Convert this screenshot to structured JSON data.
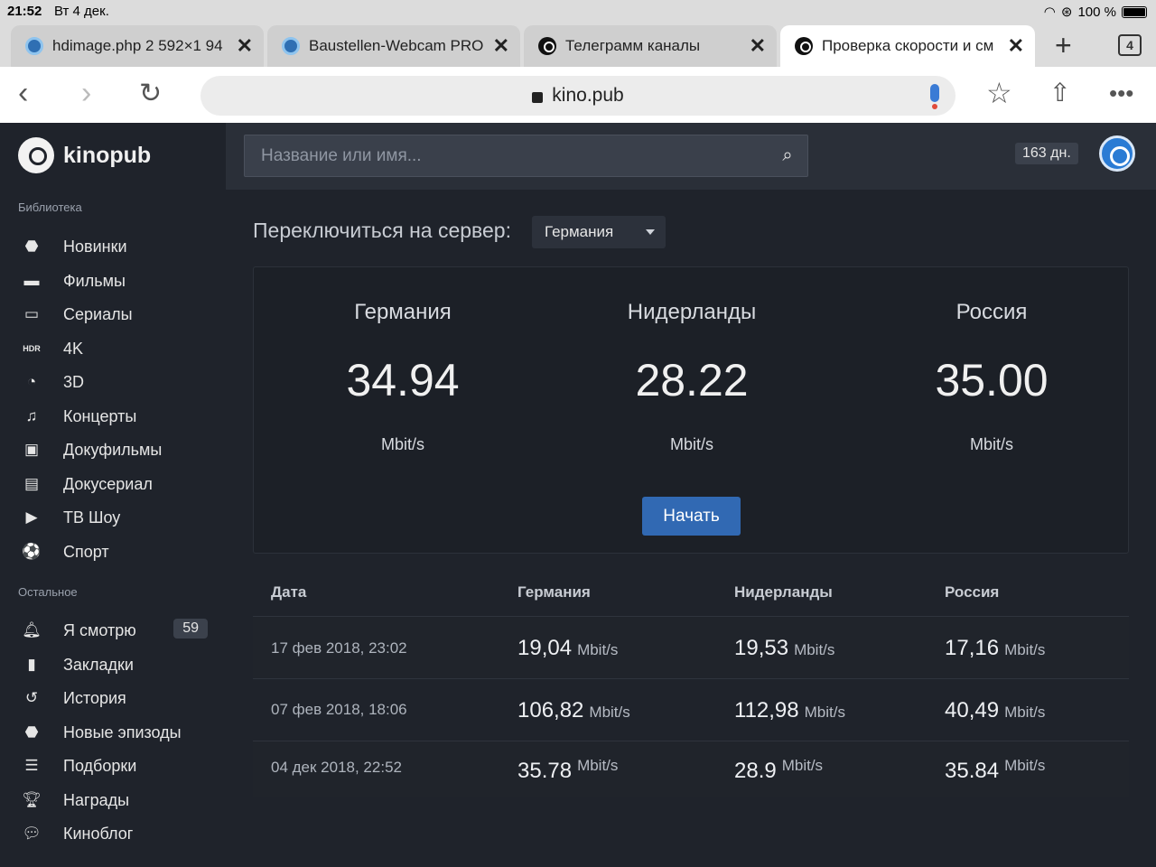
{
  "status_bar": {
    "time": "21:52",
    "date": "Вт 4 дек.",
    "battery": "100 %"
  },
  "tabs": [
    {
      "title": "hdimage.php 2 592×1 94",
      "favicon": "camera-icon"
    },
    {
      "title": "Baustellen-Webcam PRO",
      "favicon": "camera-icon"
    },
    {
      "title": "Телеграмм каналы",
      "favicon": "kinopub-icon"
    },
    {
      "title": "Проверка скорости и см",
      "favicon": "kinopub-icon",
      "active": true
    }
  ],
  "tab_count": "4",
  "address_bar": {
    "url": "kino.pub"
  },
  "sidebar": {
    "logo": "kinopub",
    "library_heading": "Библиотека",
    "library": [
      {
        "label": "Новинки",
        "icon": "alert-icon"
      },
      {
        "label": "Фильмы",
        "icon": "film-icon"
      },
      {
        "label": "Сериалы",
        "icon": "tv-icon"
      },
      {
        "label": "4K",
        "icon": "hdr-icon",
        "icon_text": "HDR"
      },
      {
        "label": "3D",
        "icon": "3d-icon"
      },
      {
        "label": "Концерты",
        "icon": "music-icon"
      },
      {
        "label": "Докуфильмы",
        "icon": "archive-icon"
      },
      {
        "label": "Докусериал",
        "icon": "document-icon"
      },
      {
        "label": "ТВ Шоу",
        "icon": "tv-show-icon"
      },
      {
        "label": "Спорт",
        "icon": "soccer-ball-icon"
      }
    ],
    "other_heading": "Остальное",
    "other": [
      {
        "label": "Я смотрю",
        "icon": "bell-icon",
        "badge": "59"
      },
      {
        "label": "Закладки",
        "icon": "bookmark-icon"
      },
      {
        "label": "История",
        "icon": "history-icon"
      },
      {
        "label": "Новые эпизоды",
        "icon": "alert-icon"
      },
      {
        "label": "Подборки",
        "icon": "list-icon"
      },
      {
        "label": "Награды",
        "icon": "trophy-icon"
      },
      {
        "label": "Киноблог",
        "icon": "chat-icon"
      }
    ]
  },
  "header": {
    "search_placeholder": "Название или имя...",
    "days_left": "163 дн."
  },
  "server_switch": {
    "label": "Переключиться на сервер:",
    "selected": "Германия"
  },
  "speedtest": {
    "results": [
      {
        "country": "Германия",
        "value": "34.94",
        "unit": "Mbit/s"
      },
      {
        "country": "Нидерланды",
        "value": "28.22",
        "unit": "Mbit/s"
      },
      {
        "country": "Россия",
        "value": "35.00",
        "unit": "Mbit/s"
      }
    ],
    "start_button": "Начать"
  },
  "history": {
    "columns": [
      "Дата",
      "Германия",
      "Нидерланды",
      "Россия"
    ],
    "rows": [
      {
        "date": "17 фев 2018, 23:02",
        "values": [
          "19,04",
          "19,53",
          "17,16"
        ],
        "unit": "Mbit/s"
      },
      {
        "date": "07 фев 2018, 18:06",
        "values": [
          "106,82",
          "112,98",
          "40,49"
        ],
        "unit": "Mbit/s"
      },
      {
        "date": "04 дек 2018, 22:52",
        "values": [
          "35.78",
          "28.9",
          "35.84"
        ],
        "unit": "Mbit/s"
      }
    ]
  },
  "colors": {
    "accent": "#3169b3",
    "sidebar_bg": "#1f232b",
    "header_bg": "#2a2f38"
  }
}
